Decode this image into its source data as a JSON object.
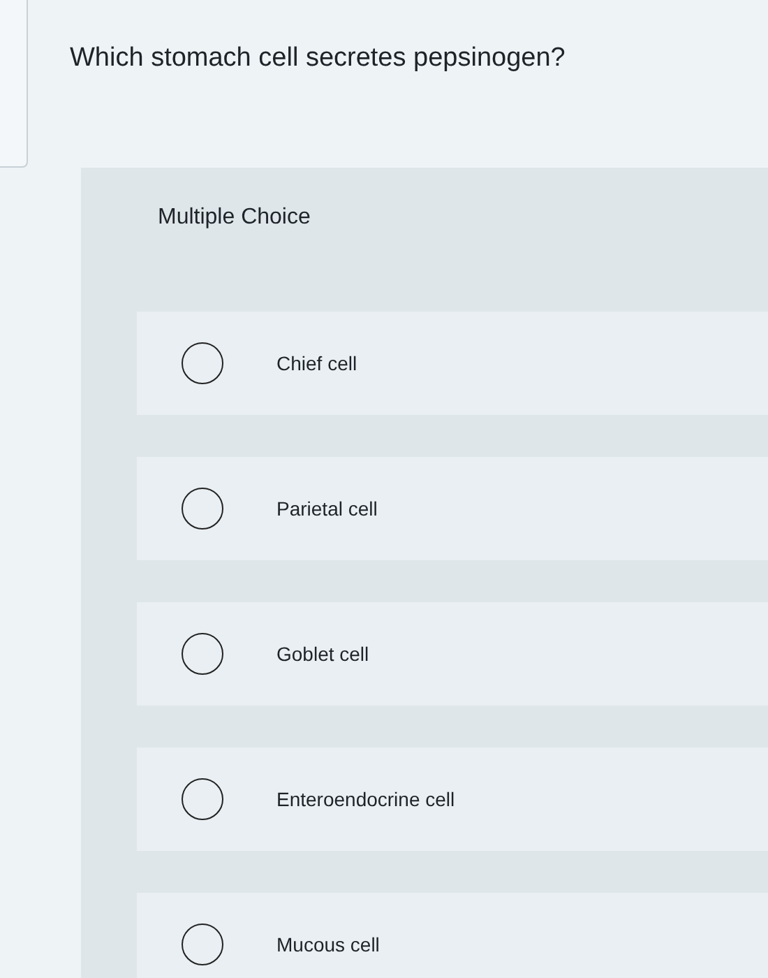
{
  "question": "Which stomach cell secretes pepsinogen?",
  "question_type": "Multiple Choice",
  "options": [
    {
      "label": "Chief cell",
      "selected": false
    },
    {
      "label": "Parietal cell",
      "selected": false
    },
    {
      "label": "Goblet cell",
      "selected": false
    },
    {
      "label": "Enteroendocrine cell",
      "selected": false
    },
    {
      "label": "Mucous cell",
      "selected": false
    }
  ]
}
